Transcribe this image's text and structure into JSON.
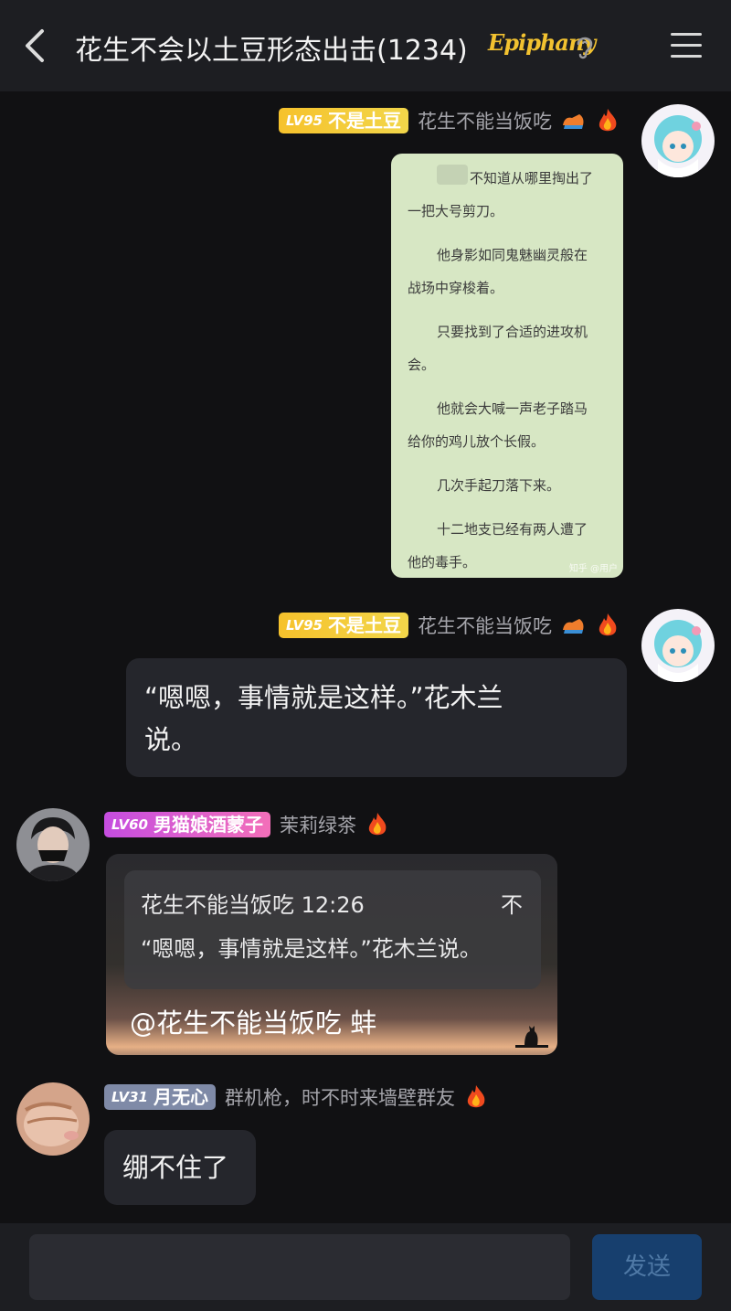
{
  "header": {
    "title": "花生不会以土豆形态出击(1234)",
    "brand": "Epiphany",
    "icons": [
      "back-icon",
      "ear-icon",
      "menu-icon"
    ]
  },
  "messages": [
    {
      "id": "m1",
      "side": "right",
      "level": "LV95",
      "title": "不是土豆",
      "username": "花生不能当饭吃",
      "type": "image",
      "image_lines": [
        "不知道从哪里掏出了",
        "一把大号剪刀。",
        "他身影如同鬼魅幽灵般在",
        "战场中穿梭着。",
        "只要找到了合适的进攻机",
        "会。",
        "他就会大喊一声老子踏马",
        "给你的鸡儿放个长假。",
        "几次手起刀落下来。",
        "十二地支已经有两人遭了",
        "他的毒手。"
      ],
      "watermark": "知乎 @用户"
    },
    {
      "id": "m2",
      "side": "right",
      "level": "LV95",
      "title": "不是土豆",
      "username": "花生不能当饭吃",
      "type": "text",
      "text_line1": "“嗯嗯，事情就是这样。”花木兰",
      "text_line2": "说。"
    },
    {
      "id": "m3",
      "side": "left",
      "level": "LV60",
      "title": "男猫娘酒蒙子",
      "username": "茉莉绿茶",
      "type": "reply",
      "quote_header": "花生不能当饭吃 12:26",
      "quote_tail": "不",
      "quote_text": "“嗯嗯，事情就是这样。”花木兰说。",
      "text": "@花生不能当饭吃 蚌"
    },
    {
      "id": "m4",
      "side": "left",
      "level": "LV31",
      "title": "月无心",
      "username": "群机枪，时不时来墙壁群友",
      "type": "text",
      "text": "绷不住了"
    }
  ],
  "composer": {
    "placeholder": "",
    "send_label": "发送"
  },
  "colors": {
    "background": "#111113",
    "bubble": "#25262c",
    "level_gold": "#f6c22c",
    "level_pink": "#e05ccf",
    "level_gray": "#7f8aa7",
    "send_button": "#173f6e"
  }
}
